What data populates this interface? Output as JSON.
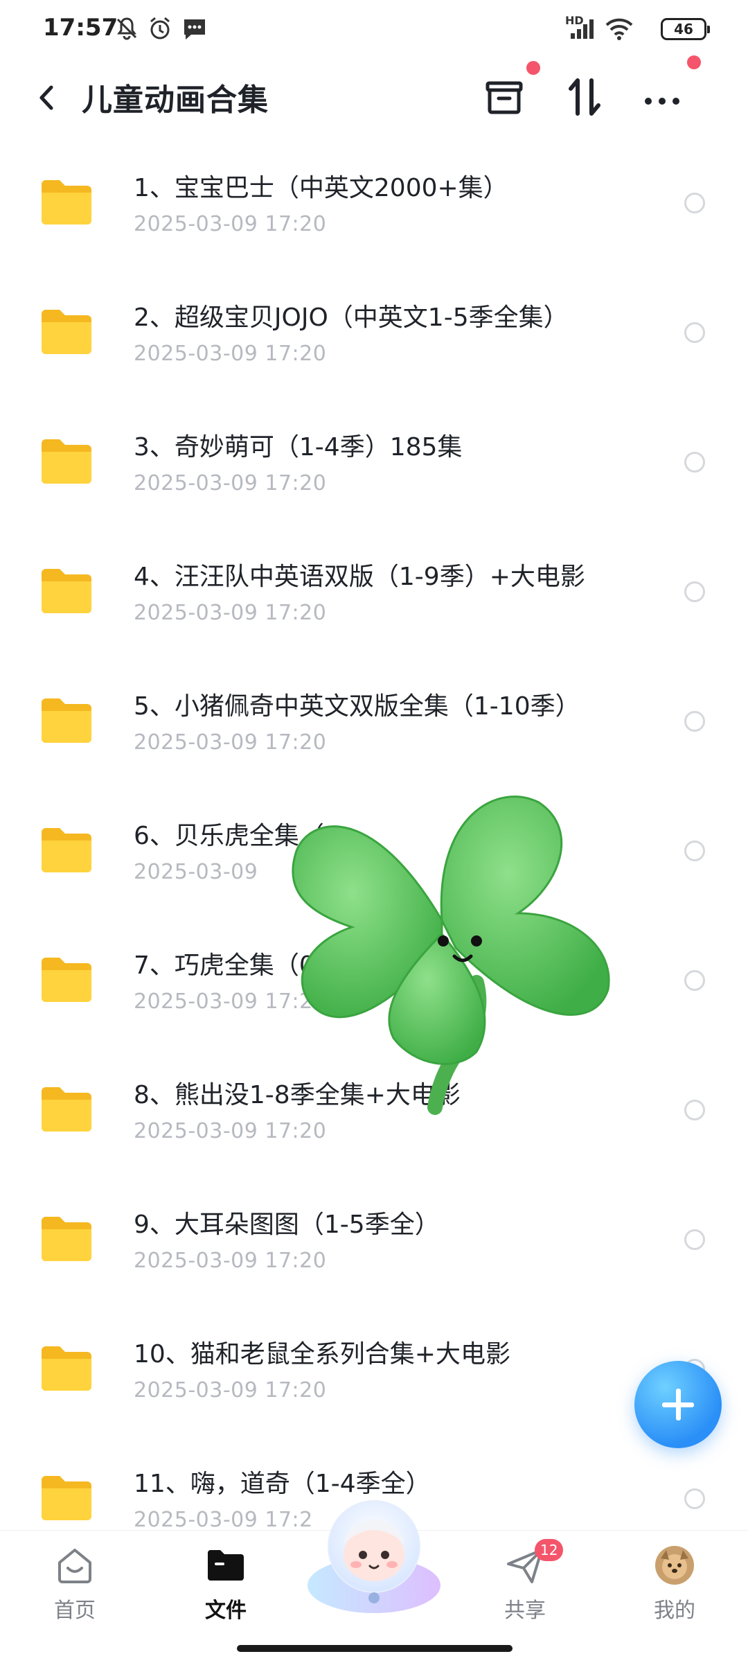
{
  "status_bar": {
    "time": "17:57",
    "network_label": "HD",
    "battery": "46",
    "icons": [
      "mute-bell-icon",
      "alarm-icon",
      "message-icon",
      "signal-icon",
      "wifi-icon",
      "battery-icon"
    ]
  },
  "header": {
    "title": "儿童动画合集",
    "back_icon": "chevron-left-icon",
    "actions": [
      "archive-icon",
      "sort-icon",
      "more-icon"
    ],
    "accent_dot_color": "#f4556b"
  },
  "files": [
    {
      "name": "1、宝宝巴士（中英文2000+集）",
      "date": "2025-03-09  17:20"
    },
    {
      "name": "2、超级宝贝JOJO（中英文1-5季全集）",
      "date": "2025-03-09  17:20"
    },
    {
      "name": "3、奇妙萌可（1-4季）185集",
      "date": "2025-03-09  17:20"
    },
    {
      "name": "4、汪汪队中英语双版（1-9季）+大电影",
      "date": "2025-03-09  17:20"
    },
    {
      "name": "5、小猪佩奇中英文双版全集（1-10季）",
      "date": "2025-03-09  17:20"
    },
    {
      "name": "6、贝乐虎全集（",
      "date": "2025-03-09"
    },
    {
      "name": "7、巧虎全集（0-7",
      "date": "2025-03-09  17:2"
    },
    {
      "name": "8、熊出没1-8季全集+大电影",
      "date": "2025-03-09  17:20"
    },
    {
      "name": "9、大耳朵图图（1-5季全）",
      "date": "2025-03-09  17:20"
    },
    {
      "name": "10、猫和老鼠全系列合集+大电影",
      "date": "2025-03-09  17:20"
    },
    {
      "name": "11、嗨，道奇（1-4季全）",
      "date": "2025-03-09  17:2"
    }
  ],
  "fab": {
    "icon": "plus-icon",
    "color": "#2a8ff7"
  },
  "nav": {
    "items": [
      {
        "label": "首页",
        "icon": "home-icon"
      },
      {
        "label": "文件",
        "icon": "folder-icon"
      },
      {
        "label": "共享",
        "icon": "send-icon",
        "badge": "12"
      },
      {
        "label": "我的",
        "icon": "avatar-icon"
      }
    ]
  },
  "colors": {
    "folder": "#ffc929",
    "date_text": "#b6b9bf",
    "badge": "#f4556b"
  }
}
